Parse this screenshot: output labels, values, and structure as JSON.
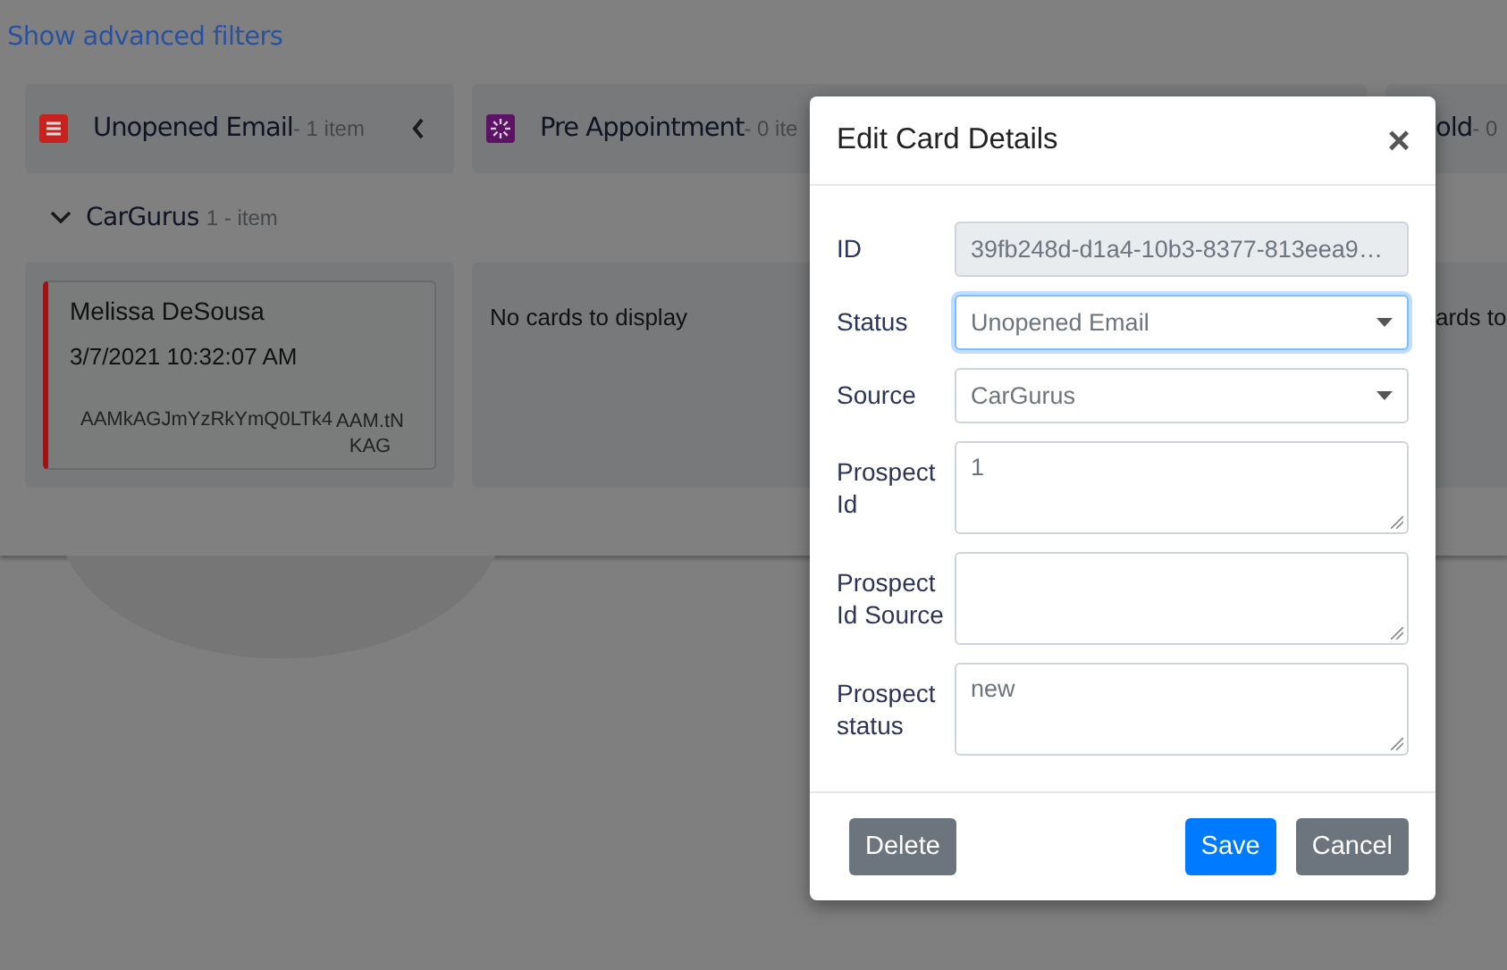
{
  "filters_link": "Show advanced filters",
  "columns": [
    {
      "title": "Unopened Email",
      "count": "- 1 item",
      "color": "#c8221e",
      "kind": "list",
      "collapsible": true,
      "cards": [
        {
          "name": "Melissa DeSousa",
          "date": "3/7/2021 10:32:07 AM",
          "ref": "AAMkAGJmYzRkYmQ0LTk4",
          "ref_tail": "AAM.tN KAG",
          "color": "#a01214"
        }
      ]
    },
    {
      "title": "Pre Appointment",
      "count": "- 0 ite",
      "color": "#5e1266",
      "kind": "spinner",
      "collapsible": false,
      "empty": "No cards to display"
    },
    {
      "title": "old",
      "count": "- 0",
      "kind": "plain",
      "collapsible": false,
      "empty": "ards to"
    }
  ],
  "swimlane": {
    "label": "CarGurus",
    "count": "1 - item",
    "expanded": true
  },
  "modal": {
    "title": "Edit Card Details",
    "close": "×",
    "fields": [
      {
        "label": "ID",
        "kind": "readonly",
        "value": "39fb248d-d1a4-10b3-8377-813eea9…"
      },
      {
        "label": "Status",
        "kind": "select",
        "value": "Unopened Email",
        "focused": true
      },
      {
        "label": "Source",
        "kind": "select",
        "value": "CarGurus",
        "focused": false
      },
      {
        "label": "Prospect Id",
        "kind": "textarea",
        "value": "1"
      },
      {
        "label": "Prospect Id Source",
        "kind": "textarea"
      },
      {
        "label": "Prospect status",
        "kind": "textarea",
        "value": "new"
      }
    ],
    "buttons": [
      {
        "label": "Delete",
        "kind": "secondary"
      },
      {
        "label": "Save",
        "kind": "primary"
      },
      {
        "label": "Cancel",
        "kind": "secondary"
      }
    ]
  }
}
